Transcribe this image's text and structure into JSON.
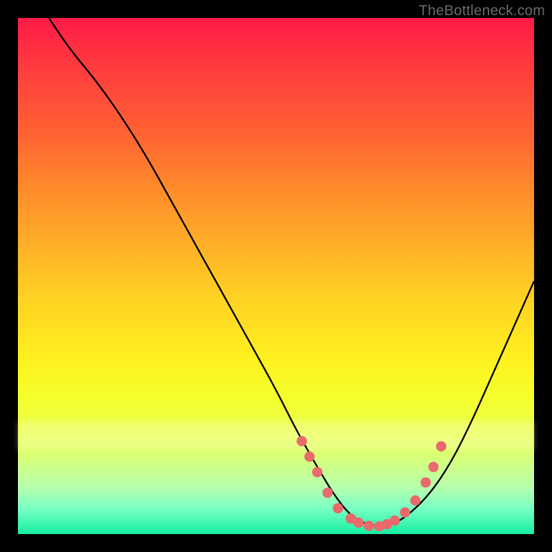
{
  "watermark": "TheBottleneck.com",
  "colors": {
    "curve": "#000000",
    "markers": "#e96a6d",
    "background_frame": "#000000"
  },
  "chart_data": {
    "type": "line",
    "title": "",
    "xlabel": "",
    "ylabel": "",
    "xlim": [
      0,
      100
    ],
    "ylim": [
      0,
      100
    ],
    "series": [
      {
        "name": "curve",
        "x": [
          6,
          10,
          15,
          20,
          25,
          30,
          35,
          40,
          45,
          50,
          54,
          58,
          61,
          64,
          67,
          70,
          73,
          76,
          80,
          84,
          88,
          92,
          96,
          100
        ],
        "y": [
          100,
          94,
          88,
          81,
          73,
          64,
          55,
          46,
          37,
          28,
          20,
          13,
          8,
          4,
          2,
          1.5,
          2,
          4,
          8,
          14,
          22,
          31,
          40,
          49
        ]
      }
    ],
    "markers": {
      "name": "dots",
      "x": [
        55,
        56.5,
        58,
        60,
        62,
        64.5,
        66,
        68,
        70,
        71.5,
        73,
        75,
        77,
        79,
        80.5,
        82
      ],
      "y": [
        18,
        15,
        12,
        8,
        5,
        3,
        2.2,
        1.6,
        1.5,
        1.9,
        2.6,
        4.2,
        6.5,
        10,
        13,
        17
      ]
    }
  }
}
